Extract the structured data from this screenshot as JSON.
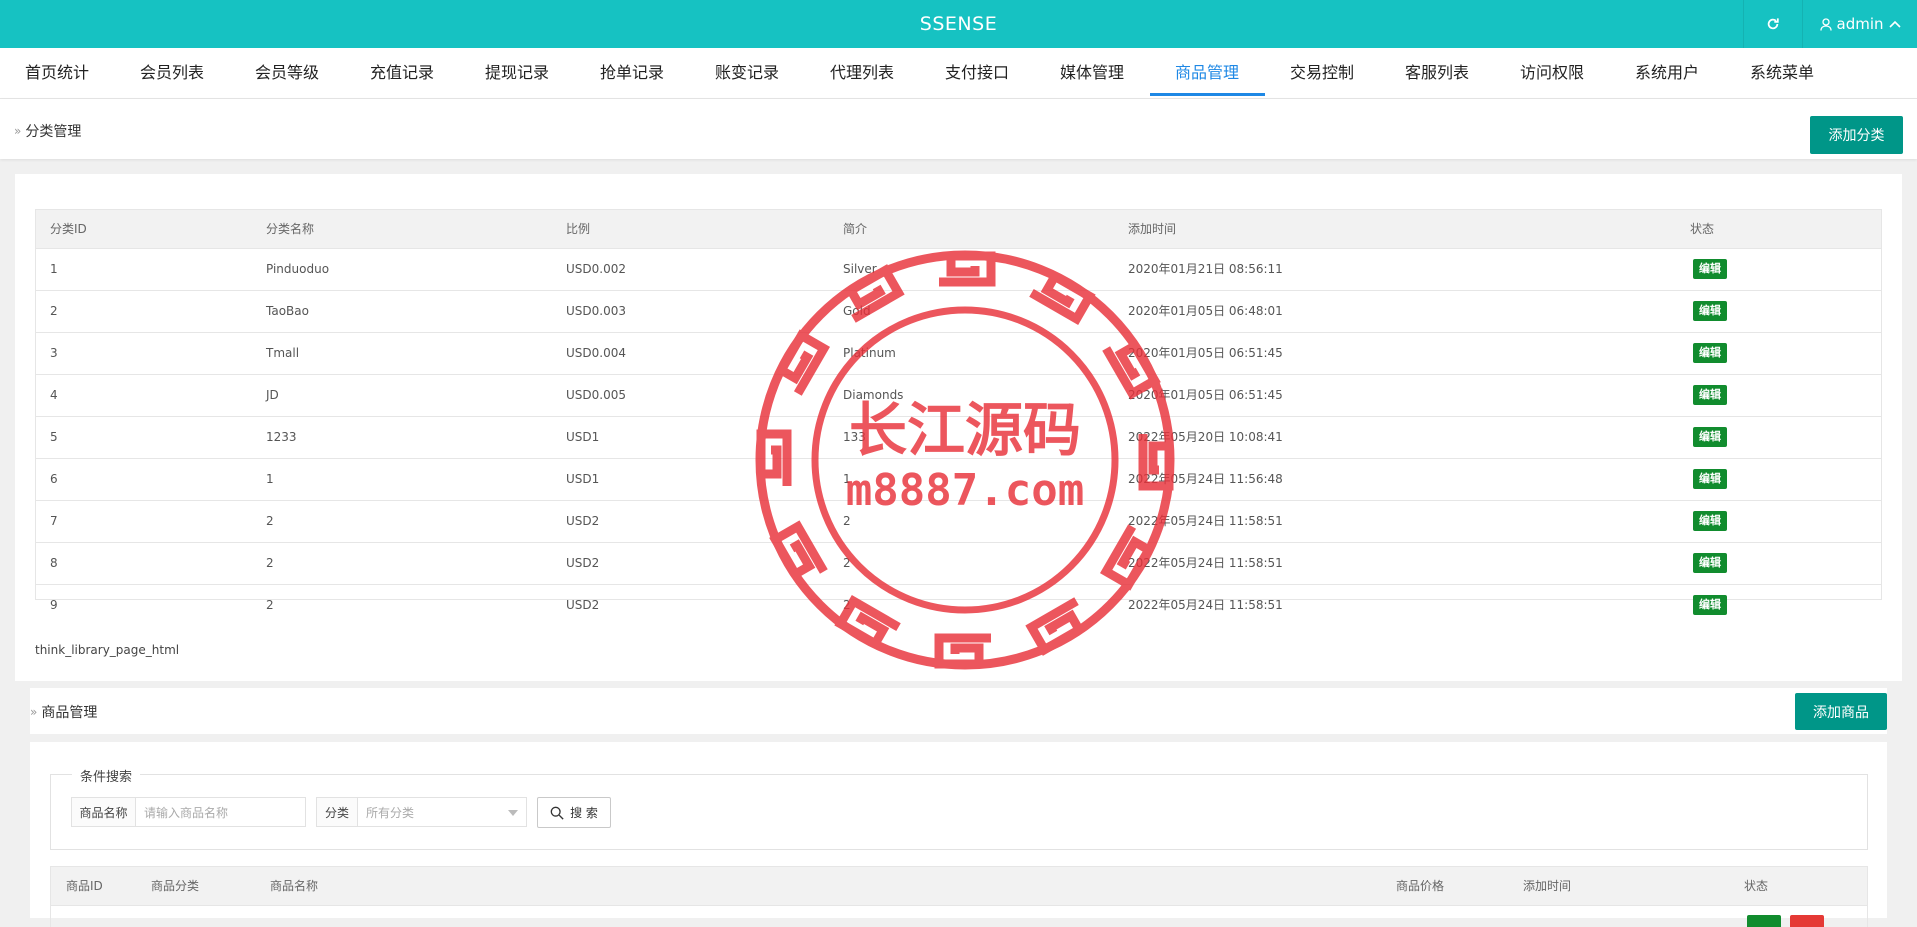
{
  "app": {
    "brand": "SSENSE",
    "user": "admin"
  },
  "nav": [
    "首页统计",
    "会员列表",
    "会员等级",
    "充值记录",
    "提现记录",
    "抢单记录",
    "账变记录",
    "代理列表",
    "支付接口",
    "媒体管理",
    "商品管理",
    "交易控制",
    "客服列表",
    "访问权限",
    "系统用户",
    "系统菜单"
  ],
  "nav_active": "商品管理",
  "category": {
    "title": "分类管理",
    "add_button": "添加分类",
    "columns": [
      "分类ID",
      "分类名称",
      "比例",
      "简介",
      "添加时间",
      "状态"
    ],
    "rows": [
      [
        "1",
        "Pinduoduo",
        "USD0.002",
        "Silver",
        "2020年01月21日 08:56:11",
        "编辑"
      ],
      [
        "2",
        "TaoBao",
        "USD0.003",
        "Gold",
        "2020年01月05日 06:48:01",
        "编辑"
      ],
      [
        "3",
        "Tmall",
        "USD0.004",
        "Platinum",
        "2020年01月05日 06:51:45",
        "编辑"
      ],
      [
        "4",
        "JD",
        "USD0.005",
        "Diamonds",
        "2020年01月05日 06:51:45",
        "编辑"
      ],
      [
        "5",
        "1233",
        "USD1",
        "133",
        "2022年05月20日 10:08:41",
        "编辑"
      ],
      [
        "6",
        "1",
        "USD1",
        "1",
        "2022年05月24日 11:56:48",
        "编辑"
      ],
      [
        "7",
        "2",
        "USD2",
        "2",
        "2022年05月24日 11:58:51",
        "编辑"
      ],
      [
        "8",
        "2",
        "USD2",
        "2",
        "2022年05月24日 11:58:51",
        "编辑"
      ],
      [
        "9",
        "2",
        "USD2",
        "2",
        "2022年05月24日 11:58:51",
        "编辑"
      ]
    ],
    "pager": "think_library_page_html"
  },
  "goods": {
    "title": "商品管理",
    "add_button": "添加商品",
    "filter": {
      "legend": "条件搜索",
      "name_label": "商品名称",
      "name_placeholder": "请输入商品名称",
      "cat_label": "分类",
      "cat_value": "所有分类",
      "search_button": "搜 索"
    },
    "columns": [
      "商品ID",
      "商品分类",
      "商品名称",
      "商品价格",
      "添加时间",
      "状态"
    ]
  },
  "watermark": {
    "line1": "长江源码",
    "line2": "m8887.com"
  },
  "colors": {
    "topbar": "#16c2c2",
    "accent": "#1e88e5",
    "teal_button": "#009688",
    "edit_badge": "#118c2e",
    "stamp": "#e8313a"
  }
}
